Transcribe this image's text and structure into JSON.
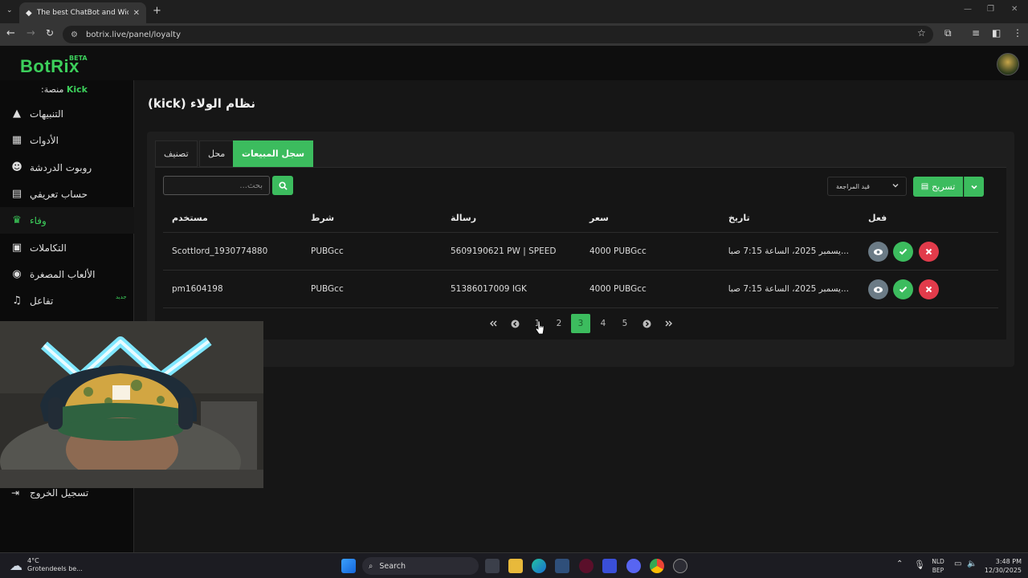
{
  "browser": {
    "tab_title": "The best ChatBot and Widgets",
    "url": "botrix.live/panel/loyalty"
  },
  "app": {
    "logo": "BotRix",
    "beta": "BETA"
  },
  "sidebar": {
    "platform_label": "منصة:",
    "platform_value": "Kick",
    "items": [
      {
        "label": "التنبيهات",
        "icon": "warning-icon"
      },
      {
        "label": "الأدوات",
        "icon": "table-icon"
      },
      {
        "label": "روبوت الدردشة",
        "icon": "robot-icon"
      },
      {
        "label": "حساب تعريفي",
        "icon": "id-card-icon"
      },
      {
        "label": "وفاء",
        "icon": "trophy-icon"
      },
      {
        "label": "التكاملات",
        "icon": "integration-icon"
      },
      {
        "label": "الألعاب المصغرة",
        "icon": "gamepad-icon"
      },
      {
        "label": "تفاعل",
        "icon": "music-icon"
      }
    ],
    "new_badge": "جديد",
    "logout": "تسجيل الخروج"
  },
  "main": {
    "title": "نظام الولاء (kick)",
    "tabs": [
      "تصنيف",
      "محل",
      "سجل المبيعات"
    ],
    "active_tab": "سجل المبيعات",
    "search_placeholder": "بحث...",
    "filter_value": "قيد المراجعة",
    "export_label": "تسريح",
    "table": {
      "headers": {
        "user": "مستخدم",
        "condition": "شرط",
        "message": "رسالة",
        "price": "سعر",
        "date": "تاريخ",
        "action": "فعل"
      },
      "rows": [
        {
          "user": "Scottlord_1930774880",
          "condition": "PUBGcc",
          "message": "5609190621 PW | SPEED",
          "price": "4000 PUBGcc",
          "date": "...يسمبر 2025، الساعة 7:15 صباحًا"
        },
        {
          "user": "pm1604198",
          "condition": "PUBGcc",
          "message": "51386017009 IGK",
          "price": "4000 PUBGcc",
          "date": "...يسمبر 2025، الساعة 7:15 صباحًا"
        }
      ]
    },
    "pagination": {
      "pages": [
        "1",
        "2",
        "3",
        "4",
        "5"
      ],
      "current": "3"
    }
  },
  "taskbar": {
    "weather_temp": "4°C",
    "weather_desc": "Grotendeels be...",
    "search_label": "Search",
    "lang_top": "NLD",
    "lang_bottom": "BEP",
    "time": "3:48 PM",
    "date": "12/30/2025"
  },
  "colors": {
    "accent": "#3cbc5e",
    "danger": "#e23b4b",
    "view": "#6b7b86"
  }
}
